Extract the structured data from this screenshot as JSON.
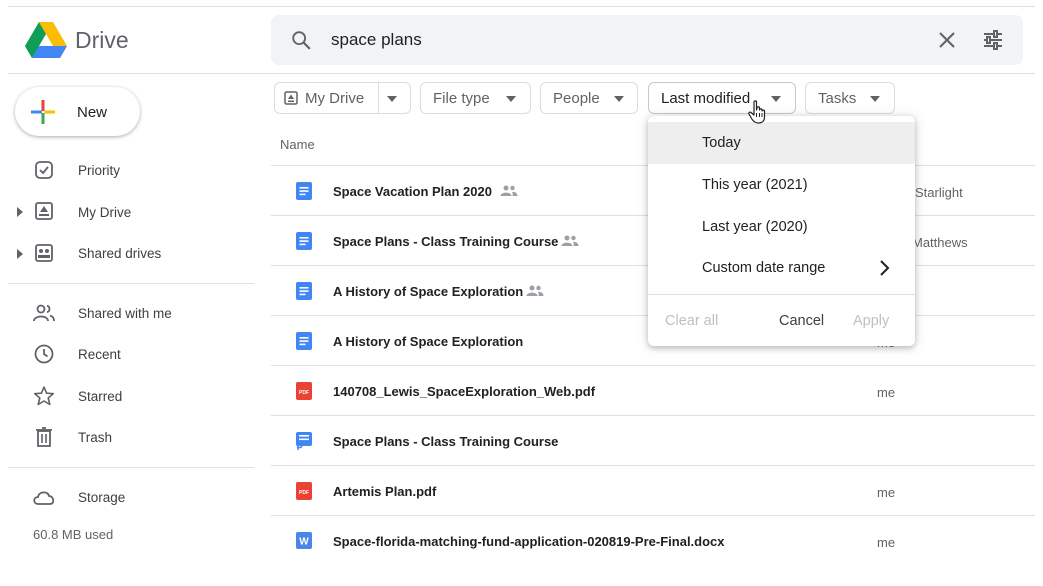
{
  "app": {
    "title": "Drive"
  },
  "search": {
    "query": "space plans"
  },
  "sidebar": {
    "new_label": "New",
    "items": [
      {
        "label": "Priority",
        "icon": "priority-icon"
      },
      {
        "label": "My Drive",
        "icon": "my-drive-icon"
      },
      {
        "label": "Shared drives",
        "icon": "shared-drives-icon"
      },
      {
        "label": "Shared with me",
        "icon": "people-icon"
      },
      {
        "label": "Recent",
        "icon": "clock-icon"
      },
      {
        "label": "Starred",
        "icon": "star-icon"
      },
      {
        "label": "Trash",
        "icon": "trash-icon"
      },
      {
        "label": "Storage",
        "icon": "cloud-icon"
      }
    ],
    "storage_used": "60.8 MB used"
  },
  "filters": {
    "location": "My Drive",
    "file_type": "File type",
    "people": "People",
    "last_modified": "Last modified",
    "tasks": "Tasks"
  },
  "list": {
    "column_name": "Name",
    "rows": [
      {
        "name": "Space Vacation Plan 2020",
        "type": "doc",
        "shared": true,
        "owner": "Starlight"
      },
      {
        "name": "Space Plans - Class Training Course",
        "type": "doc",
        "shared": true,
        "owner": "Matthews"
      },
      {
        "name": "A History of Space Exploration",
        "type": "doc",
        "shared": true,
        "owner": ""
      },
      {
        "name": "A History of Space Exploration",
        "type": "doc",
        "shared": false,
        "owner": "me"
      },
      {
        "name": "140708_Lewis_SpaceExploration_Web.pdf",
        "type": "pdf",
        "shared": false,
        "owner": "me"
      },
      {
        "name": "Space Plans - Class Training Course",
        "type": "form",
        "shared": false,
        "owner": ""
      },
      {
        "name": "Artemis Plan.pdf",
        "type": "pdf",
        "shared": false,
        "owner": "me"
      },
      {
        "name": "Space-florida-matching-fund-application-020819-Pre-Final.docx",
        "type": "word",
        "shared": false,
        "owner": "me"
      }
    ]
  },
  "dropdown": {
    "options": [
      "Today",
      "This year (2021)",
      "Last year (2020)",
      "Custom date range"
    ],
    "clear_all": "Clear all",
    "cancel": "Cancel",
    "apply": "Apply"
  },
  "colors": {
    "doc_blue": "#4285f4",
    "pdf_red": "#ea4335",
    "word_blue": "#2b579a",
    "menu_highlight": "#eeeeee"
  }
}
